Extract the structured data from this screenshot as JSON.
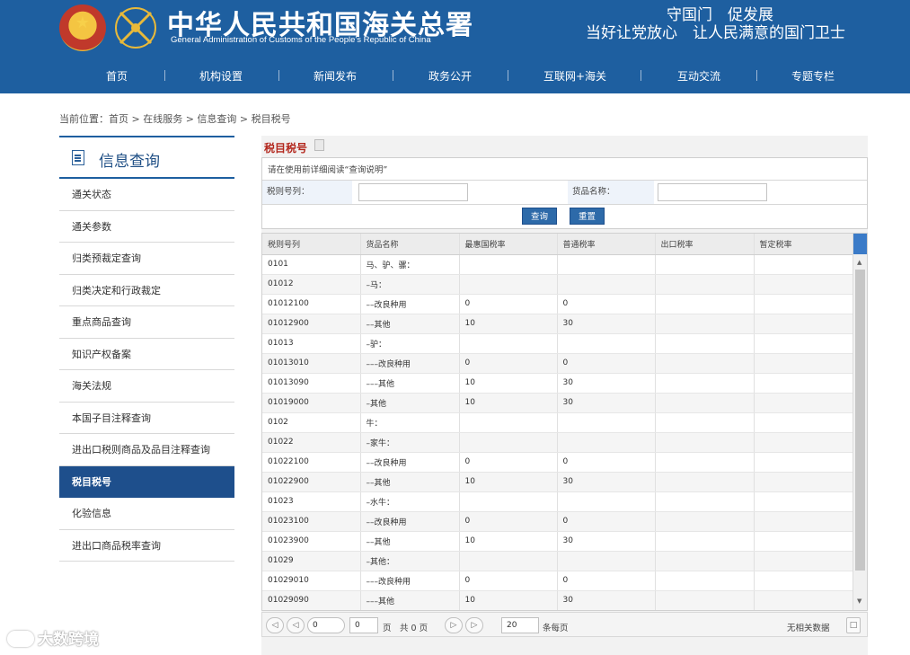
{
  "header": {
    "title_cn": "中华人民共和国海关总署",
    "title_en": "General Administration of Customs of the People's Republic of China",
    "slogan_line1": "守国门　促发展",
    "slogan_line2": "当好让党放心　让人民满意的国门卫士",
    "bg_color": "#1e5fa0"
  },
  "nav": {
    "items": [
      "首页",
      "机构设置",
      "新闻发布",
      "政务公开",
      "互联网+海关",
      "互动交流",
      "专题专栏"
    ]
  },
  "breadcrumb": {
    "prefix": "当前位置：",
    "items": [
      "首页",
      "在线服务",
      "信息查询",
      "税目税号"
    ],
    "separator": " > "
  },
  "sidebar": {
    "title": "信息查询",
    "items": [
      "通关状态",
      "通关参数",
      "归类预裁定查询",
      "归类决定和行政裁定",
      "重点商品查询",
      "知识产权备案",
      "海关法规",
      "本国子目注释查询",
      "进出口税则商品及品目注释查询",
      "税目税号",
      "化验信息",
      "进出口商品税率查询"
    ],
    "active": "税目税号"
  },
  "panel": {
    "title": "税目税号",
    "note": "请在使用前详细阅读“查询说明”",
    "code_label": "税则号列：",
    "code_value": "",
    "name_label": "货品名称：",
    "name_value": "",
    "query_button": "查询",
    "reset_button": "重置"
  },
  "grid": {
    "columns": [
      "税则号列",
      "货品名称",
      "最惠国税率",
      "普通税率",
      "出口税率",
      "暂定税率"
    ],
    "rows": [
      [
        "0101",
        "马、驴、骡：",
        "",
        "",
        "",
        ""
      ],
      [
        "01012",
        "–马：",
        "",
        "",
        "",
        ""
      ],
      [
        "01012100",
        "––改良种用",
        "0",
        "0",
        "",
        ""
      ],
      [
        "01012900",
        "––其他",
        "10",
        "30",
        "",
        ""
      ],
      [
        "01013",
        "–驴：",
        "",
        "",
        "",
        ""
      ],
      [
        "01013010",
        "–––改良种用",
        "0",
        "0",
        "",
        ""
      ],
      [
        "01013090",
        "–––其他",
        "10",
        "30",
        "",
        ""
      ],
      [
        "01019000",
        "–其他",
        "10",
        "30",
        "",
        ""
      ],
      [
        "0102",
        "牛：",
        "",
        "",
        "",
        ""
      ],
      [
        "01022",
        "–家牛：",
        "",
        "",
        "",
        ""
      ],
      [
        "01022100",
        "––改良种用",
        "0",
        "0",
        "",
        ""
      ],
      [
        "01022900",
        "––其他",
        "10",
        "30",
        "",
        ""
      ],
      [
        "01023",
        "–水牛：",
        "",
        "",
        "",
        ""
      ],
      [
        "01023100",
        "––改良种用",
        "0",
        "0",
        "",
        ""
      ],
      [
        "01023900",
        "––其他",
        "10",
        "30",
        "",
        ""
      ],
      [
        "01029",
        "–其他：",
        "",
        "",
        "",
        ""
      ],
      [
        "01029010",
        "–––改良种用",
        "0",
        "0",
        "",
        ""
      ],
      [
        "01029090",
        "–––其他",
        "10",
        "30",
        "",
        ""
      ]
    ]
  },
  "pager": {
    "first_icon": "first-page-icon",
    "prev_icon": "prev-page-icon",
    "page_input": "0",
    "page_value": "0",
    "page_label": "页",
    "total_label": "共 0 页",
    "page_size": "20",
    "per_page_label": "条每页",
    "no_data_text": "无相关数据"
  },
  "watermark": {
    "text": "大数跨境"
  }
}
